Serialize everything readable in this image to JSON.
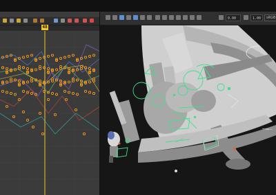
{
  "app": {
    "current_frame": "48"
  },
  "viewport_toolbar": {
    "field_1": "0.00",
    "field_2": "1.00",
    "color_space": "sRGB gamma"
  },
  "colors": {
    "timeline_playhead": "#f2c628",
    "selected_key": "#f29b20",
    "rig_control": "#3fe08a",
    "curve_blue": "#4a7ad8",
    "curve_green": "#57b86a"
  },
  "icons": {
    "camera": "camera-icon",
    "grid": "grid-icon",
    "shading": "shading-icon",
    "lighting": "lighting-icon",
    "isolate": "isolate-icon",
    "xray": "xray-icon"
  }
}
